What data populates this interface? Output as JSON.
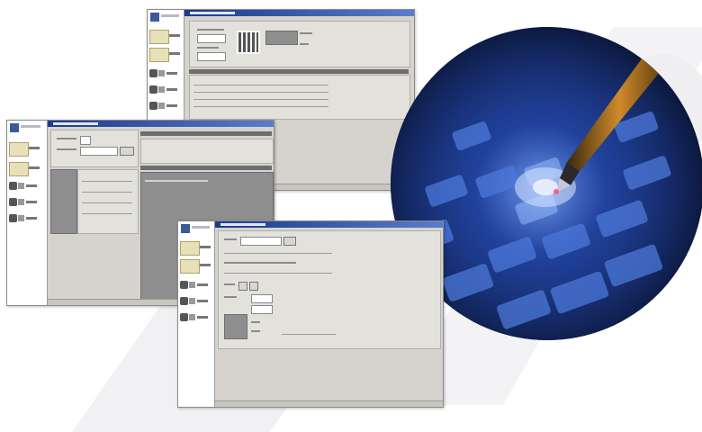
{
  "scene": {
    "background_color": "#ffffff",
    "accent_color": "#1b3a8c",
    "photo_glow_color": "#7aa8ff"
  },
  "windows": [
    {
      "name": "top-window",
      "title_bar_color": "#1b3a8c",
      "icon": "window-icon"
    },
    {
      "name": "left-window",
      "title_bar_color": "#1b3a8c",
      "icon": "window-icon"
    },
    {
      "name": "bottom-window",
      "title_bar_color": "#1b3a8c",
      "icon": "window-icon"
    }
  ],
  "photo": {
    "subject_icon": "pen-on-keyboard-icon"
  }
}
